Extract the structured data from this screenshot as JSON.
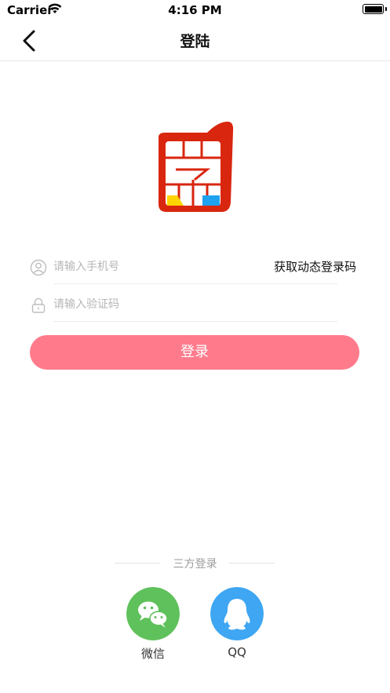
{
  "status_bar": {
    "carrier": "Carrier",
    "time": "4:16 PM"
  },
  "nav": {
    "title": "登陆"
  },
  "form": {
    "phone_placeholder": "请输入手机号",
    "get_code_label": "获取动态登录码",
    "code_placeholder": "请输入验证码",
    "login_label": "登录"
  },
  "third_party": {
    "title": "三方登录",
    "options": [
      {
        "label": "微信",
        "color": "#5fc15b"
      },
      {
        "label": "QQ",
        "color": "#3ea6f2"
      }
    ]
  },
  "colors": {
    "accent": "#ff7b8c",
    "logo_red": "#d9260f"
  },
  "icons": [
    "back-icon",
    "wifi-icon",
    "battery-icon",
    "user-icon",
    "lock-icon",
    "wechat-icon",
    "qq-icon",
    "app-logo"
  ]
}
